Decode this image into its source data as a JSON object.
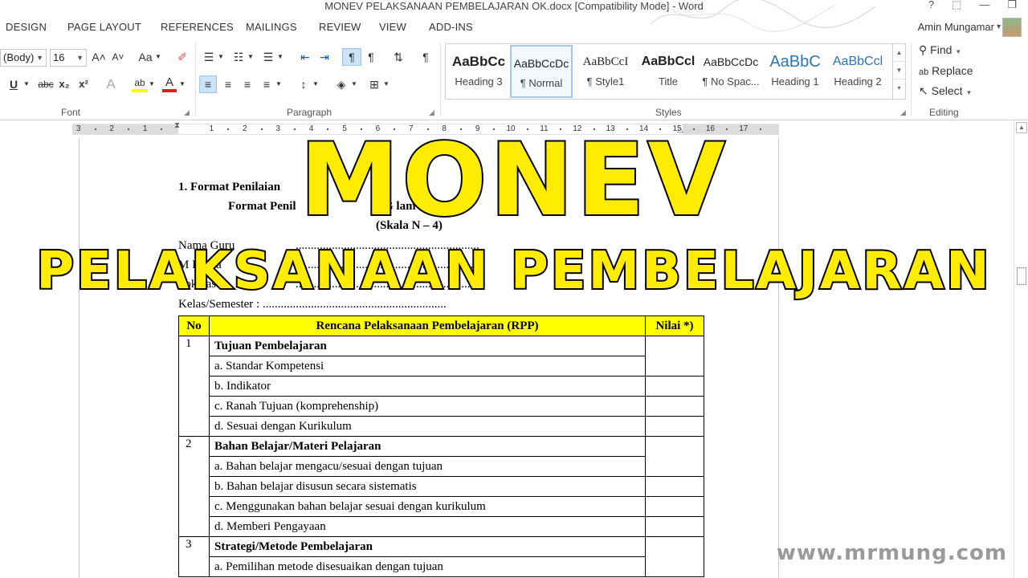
{
  "window": {
    "title": "MONEV PELAKSANAAN PEMBELAJARAN OK.docx [Compatibility Mode] - Word",
    "help": "?",
    "buttons": [
      "⬚",
      "—",
      "❐"
    ]
  },
  "ribbon_tabs": [
    "DESIGN",
    "PAGE LAYOUT",
    "REFERENCES",
    "MAILINGS",
    "REVIEW",
    "VIEW",
    "ADD-INS"
  ],
  "user": {
    "name": "Amin Mungamar"
  },
  "font_group": {
    "label": "Font",
    "font_name": "(Body)",
    "font_size": "16",
    "grow": "A˄",
    "shrink": "A˅",
    "case": "Aa",
    "underline": "U",
    "strikethrough": "abc",
    "subscript": "x₂",
    "superscript": "x²",
    "effects": "A",
    "highlight": "ab",
    "color": "A"
  },
  "paragraph_group": {
    "label": "Paragraph",
    "show_marks": "¶"
  },
  "styles_group": {
    "label": "Styles",
    "items": [
      {
        "preview": "AaBbCc",
        "name": "Heading 3",
        "color": "#1a1a1a"
      },
      {
        "preview": "AaBbCcDc",
        "name": "¶ Normal",
        "color": "#1a1a1a"
      },
      {
        "preview": "AaBbCcI",
        "name": "¶ Style1",
        "color": "#1a1a1a"
      },
      {
        "preview": "AaBbCcl",
        "name": "Title",
        "color": "#1a1a1a"
      },
      {
        "preview": "AaBbCcDc",
        "name": "¶ No Spac...",
        "color": "#1a1a1a"
      },
      {
        "preview": "AaBbC",
        "name": "Heading 1",
        "color": "#2e74b5"
      },
      {
        "preview": "AaBbCcl",
        "name": "Heading 2",
        "color": "#2e74b5"
      }
    ]
  },
  "editing_group": {
    "label": "Editing",
    "find": "Find",
    "replace": "Replace",
    "select": "Select"
  },
  "ruler": {
    "numbers": [
      "3",
      "2",
      "1",
      "1",
      "2",
      "3",
      "4",
      "5",
      "6",
      "7",
      "8",
      "9",
      "10",
      "11",
      "12",
      "13",
      "14",
      "15",
      "16",
      "17"
    ]
  },
  "document": {
    "heading1": "1.  Format Penilaian",
    "heading2": "Format Penil",
    "heading2_right": "G        lam M          ajaran",
    "scale": "(Skala N       – 4)",
    "nama_guru": "Nama Guru",
    "mata_pelajaran": "M      Pelaja",
    "pokok": "Pok     hasan",
    "kelas": "Kelas/Semester : .............................................................",
    "dots1": ".............................................................",
    "dots2": ".............................................................",
    "dots3": "............................................................."
  },
  "table": {
    "headers": [
      "No",
      "Rencana Pelaksanaan Pembelajaran (RPP)",
      "Nilai *)"
    ],
    "sections": [
      {
        "no": "1",
        "title": "Tujuan Pembelajaran",
        "items": [
          "a.  Standar Kompetensi",
          "b. Indikator",
          "c. Ranah Tujuan (komprehenship)",
          "d. Sesuai dengan Kurikulum"
        ]
      },
      {
        "no": "2",
        "title": "Bahan Belajar/Materi Pelajaran",
        "items": [
          "a. Bahan belajar mengacu/sesuai dengan tujuan",
          "b. Bahan belajar disusun secara sistematis",
          "c. Menggunakan bahan belajar sesuai dengan kurikulum",
          "d. Memberi Pengayaan"
        ]
      },
      {
        "no": "3",
        "title": "Strategi/Metode Pembelajaran",
        "items": [
          "a. Pemilihan metode disesuaikan dengan tujuan"
        ]
      }
    ]
  },
  "overlay": {
    "line1": "MONEV",
    "line2": "PELAKSANAAN PEMBELAJARAN",
    "watermark": "www.mrmung.com",
    "fill_color": "#ffec00",
    "stroke_color": "#000000"
  }
}
